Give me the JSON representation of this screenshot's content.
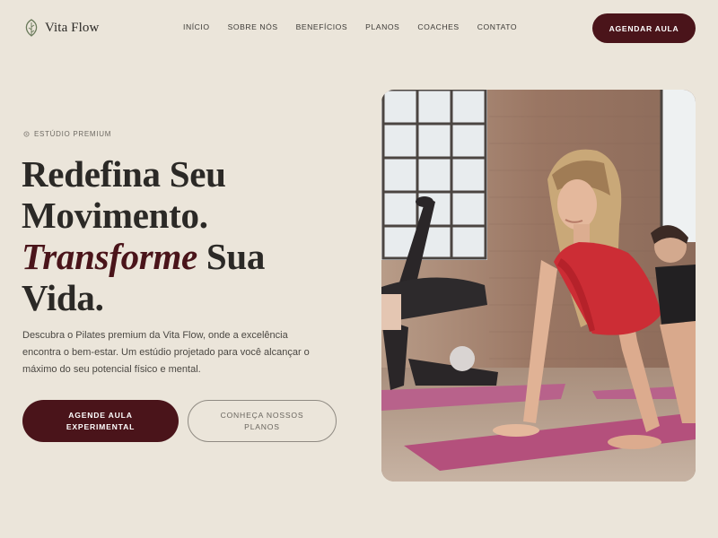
{
  "brand": {
    "name": "Vita Flow",
    "icon": "leaf-icon"
  },
  "nav": {
    "items": [
      {
        "label": "INÍCIO"
      },
      {
        "label": "SOBRE NÓS"
      },
      {
        "label": "BENEFÍCIOS"
      },
      {
        "label": "PLANOS"
      },
      {
        "label": "COACHES"
      },
      {
        "label": "CONTATO"
      }
    ],
    "cta_label": "AGENDAR AULA"
  },
  "hero": {
    "eyebrow": "ESTÚDIO PREMIUM",
    "eyebrow_icon": "circle-icon",
    "headline": {
      "line1": "Redefina Seu",
      "line2": "Movimento.",
      "line3_emphasis": "Transforme",
      "line3_rest": " Sua",
      "line4": "Vida."
    },
    "description": "Descubra o Pilates premium da Vita Flow, onde a excelência encontra o bem-estar. Um estúdio projetado para você alcançar o máximo do seu potencial físico e mental.",
    "primary_cta": "AGENDE AULA EXPERIMENTAL",
    "secondary_cta": "CONHEÇA NOSSOS PLANOS"
  },
  "colors": {
    "background": "#ebe5da",
    "accent": "#4a141a",
    "text": "#2b2926",
    "mat": "#b4507c"
  }
}
